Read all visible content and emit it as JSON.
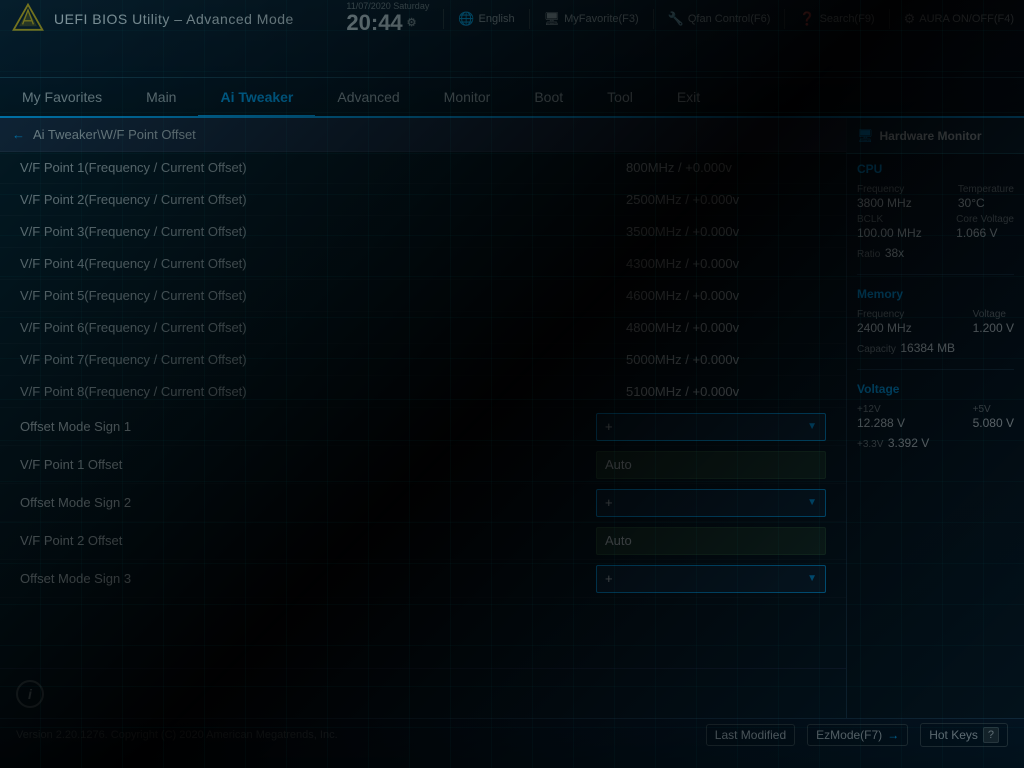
{
  "header": {
    "title": "UEFI BIOS Utility – Advanced Mode",
    "date": "11/07/2020",
    "day": "Saturday",
    "time": "20:44",
    "tools": [
      {
        "id": "language",
        "icon": "🌐",
        "label": "English"
      },
      {
        "id": "myfavorite",
        "icon": "🖥",
        "label": "MyFavorite(F3)"
      },
      {
        "id": "qfan",
        "icon": "🔧",
        "label": "Qfan Control(F6)"
      },
      {
        "id": "search",
        "icon": "❓",
        "label": "Search(F9)"
      },
      {
        "id": "aura",
        "icon": "⚙",
        "label": "AURA ON/OFF(F4)"
      }
    ]
  },
  "nav": {
    "items": [
      {
        "id": "my-favorites",
        "label": "My Favorites",
        "active": false
      },
      {
        "id": "main",
        "label": "Main",
        "active": false
      },
      {
        "id": "ai-tweaker",
        "label": "Ai Tweaker",
        "active": true
      },
      {
        "id": "advanced",
        "label": "Advanced",
        "active": false
      },
      {
        "id": "monitor",
        "label": "Monitor",
        "active": false
      },
      {
        "id": "boot",
        "label": "Boot",
        "active": false
      },
      {
        "id": "tool",
        "label": "Tool",
        "active": false
      },
      {
        "id": "exit",
        "label": "Exit",
        "active": false
      }
    ]
  },
  "breadcrumb": {
    "back_arrow": "←",
    "path": "Ai Tweaker\\W/F Point Offset"
  },
  "settings": {
    "vf_points": [
      {
        "id": "vf1",
        "label": "V/F Point 1(Frequency / Current Offset)",
        "value": "800MHz / +0.000v"
      },
      {
        "id": "vf2",
        "label": "V/F Point 2(Frequency / Current Offset)",
        "value": "2500MHz / +0.000v"
      },
      {
        "id": "vf3",
        "label": "V/F Point 3(Frequency / Current Offset)",
        "value": "3500MHz / +0.000v"
      },
      {
        "id": "vf4",
        "label": "V/F Point 4(Frequency / Current Offset)",
        "value": "4300MHz / +0.000v"
      },
      {
        "id": "vf5",
        "label": "V/F Point 5(Frequency / Current Offset)",
        "value": "4600MHz / +0.000v"
      },
      {
        "id": "vf6",
        "label": "V/F Point 6(Frequency / Current Offset)",
        "value": "4800MHz / +0.000v"
      },
      {
        "id": "vf7",
        "label": "V/F Point 7(Frequency / Current Offset)",
        "value": "5000MHz / +0.000v"
      },
      {
        "id": "vf8",
        "label": "V/F Point 8(Frequency / Current Offset)",
        "value": "5100MHz / +0.000v"
      }
    ],
    "controls": [
      {
        "id": "offset-sign-1",
        "label": "Offset Mode Sign 1",
        "type": "dropdown",
        "value": "+"
      },
      {
        "id": "vf1-offset",
        "label": "V/F Point 1 Offset",
        "type": "text",
        "value": "Auto"
      },
      {
        "id": "offset-sign-2",
        "label": "Offset Mode Sign 2",
        "type": "dropdown",
        "value": "+"
      },
      {
        "id": "vf2-offset",
        "label": "V/F Point 2 Offset",
        "type": "text",
        "value": "Auto"
      },
      {
        "id": "offset-sign-3",
        "label": "Offset Mode Sign 3",
        "type": "dropdown",
        "value": "+"
      }
    ]
  },
  "hardware_monitor": {
    "title": "Hardware Monitor",
    "sections": {
      "cpu": {
        "title": "CPU",
        "frequency_label": "Frequency",
        "frequency_value": "3800 MHz",
        "temperature_label": "Temperature",
        "temperature_value": "30°C",
        "bclk_label": "BCLK",
        "bclk_value": "100.00 MHz",
        "core_voltage_label": "Core Voltage",
        "core_voltage_value": "1.066 V",
        "ratio_label": "Ratio",
        "ratio_value": "38x"
      },
      "memory": {
        "title": "Memory",
        "frequency_label": "Frequency",
        "frequency_value": "2400 MHz",
        "voltage_label": "Voltage",
        "voltage_value": "1.200 V",
        "capacity_label": "Capacity",
        "capacity_value": "16384 MB"
      },
      "voltage": {
        "title": "Voltage",
        "v12_label": "+12V",
        "v12_value": "12.288 V",
        "v5_label": "+5V",
        "v5_value": "5.080 V",
        "v33_label": "+3.3V",
        "v33_value": "3.392 V"
      }
    }
  },
  "footer": {
    "last_modified": "Last Modified",
    "ez_mode": "EzMode(F7)",
    "hot_keys": "Hot Keys",
    "question_mark": "?",
    "copyright": "Version 2.20.1276. Copyright (C) 2020 American Megatrends, Inc."
  }
}
